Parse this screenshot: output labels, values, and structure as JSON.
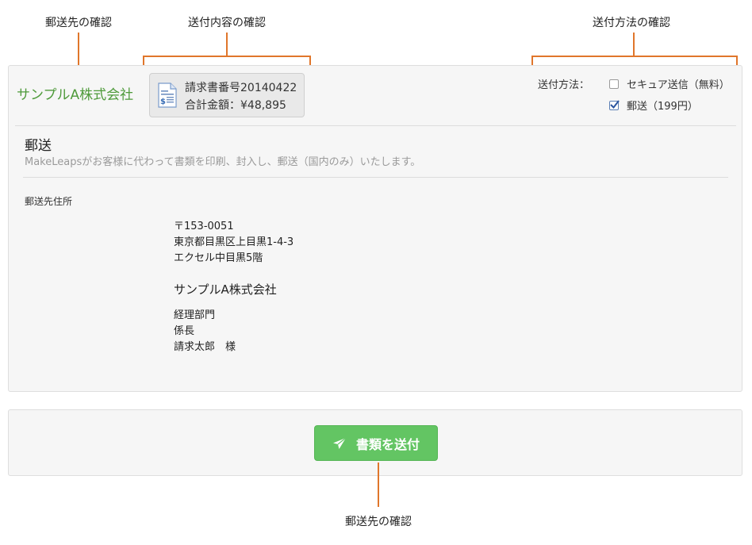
{
  "annotations": {
    "recipient_top": "郵送先の確認",
    "content": "送付内容の確認",
    "method": "送付方法の確認",
    "recipient_bottom": "郵送先の確認"
  },
  "header": {
    "company": "サンプルA株式会社",
    "document": {
      "number_line": "請求書番号20140422",
      "total_line": "合計金額：¥48,895",
      "icon": "invoice-document-icon"
    },
    "method_label": "送付方法：",
    "options": [
      {
        "label": "セキュア送信（無料）",
        "checked": false
      },
      {
        "label": "郵送（199円）",
        "checked": true
      }
    ]
  },
  "mail": {
    "title": "郵送",
    "description": "MakeLeapsがお客様に代わって書類を印刷、封入し、郵送（国内のみ）いたします。",
    "address_label": "郵送先住所",
    "postal_code": "〒153-0051",
    "address_line1": "東京都目黒区上目黒1-4-3",
    "address_line2": "エクセル中目黒5階",
    "company": "サンプルA株式会社",
    "department": "経理部門",
    "position": "係長",
    "person": "請求太郎　様"
  },
  "actions": {
    "send_label": "書類を送付",
    "send_icon": "paper-plane-icon"
  },
  "colors": {
    "accent_green": "#63c563",
    "company_green": "#4e9a3a",
    "annotation_orange": "#e0762b"
  }
}
